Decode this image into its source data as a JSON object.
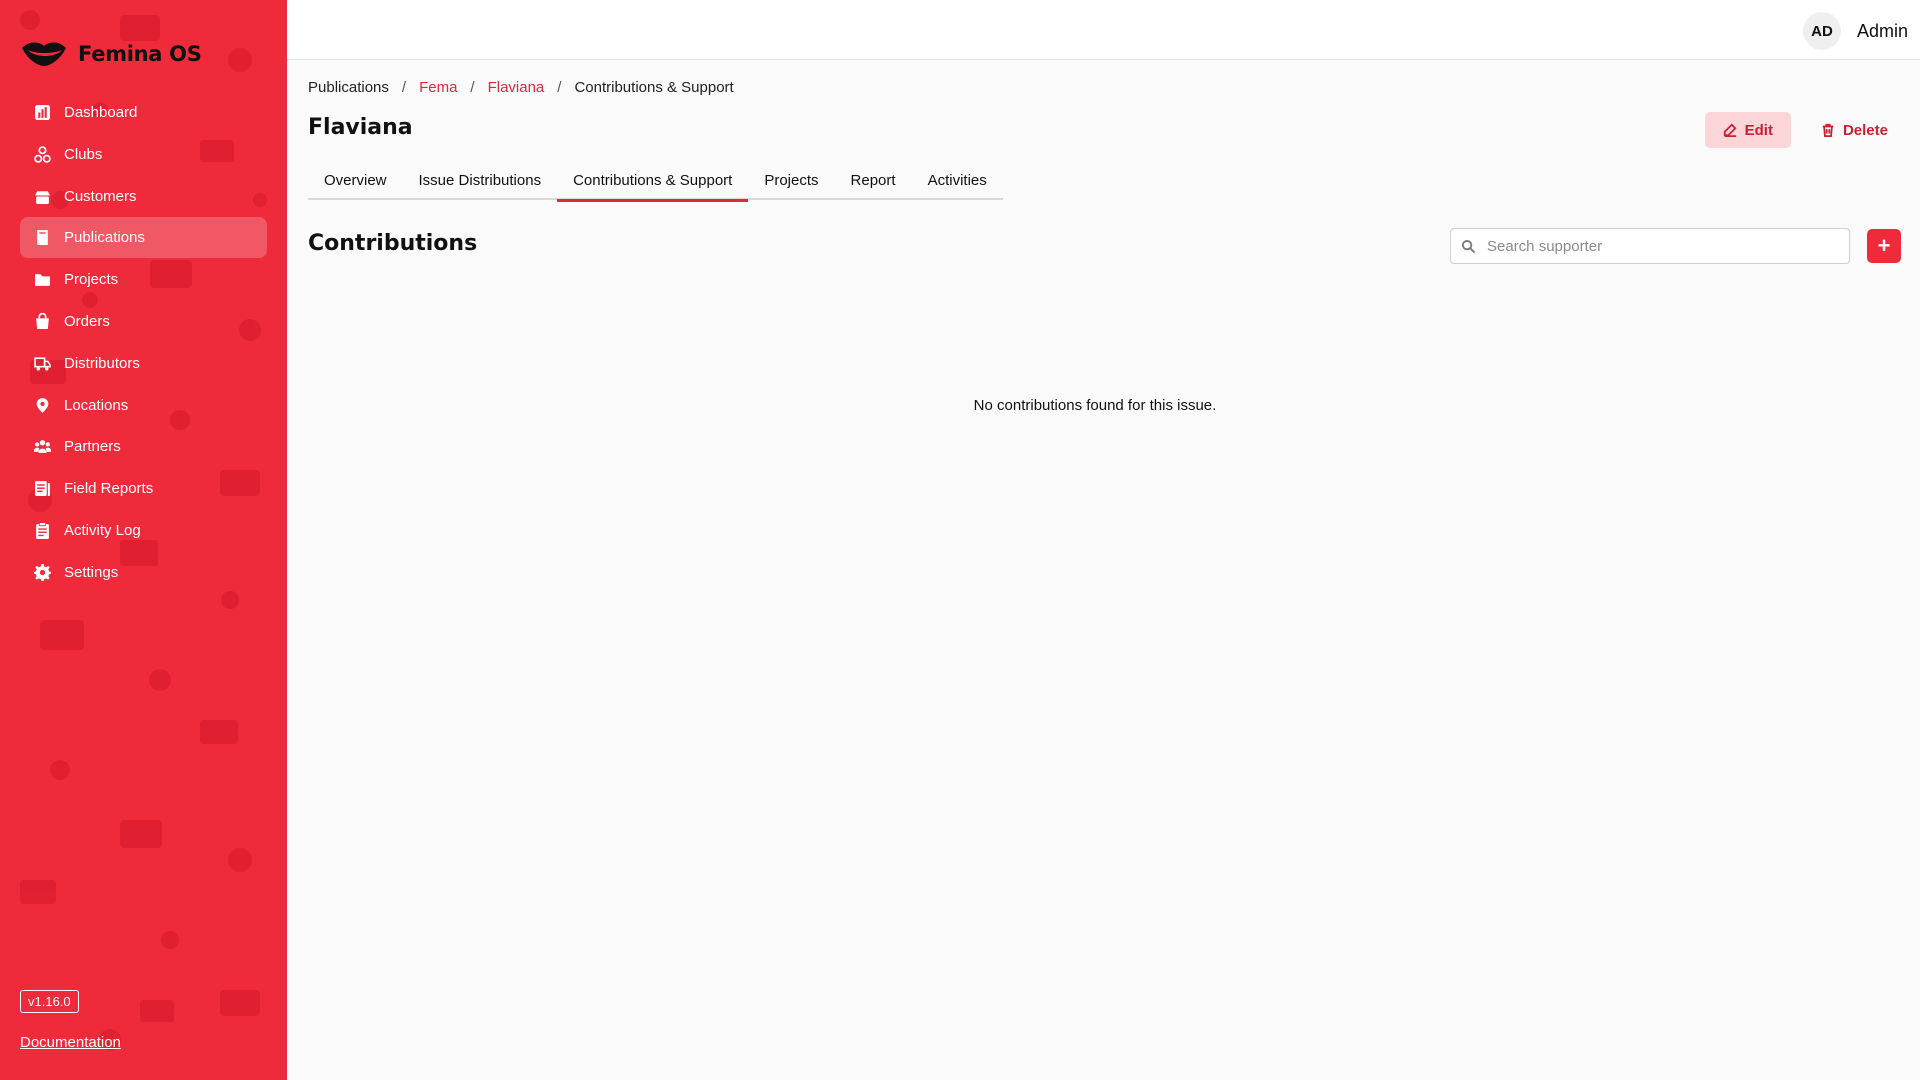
{
  "app": {
    "name": "Femina OS",
    "accent_color": "#ee2a3b",
    "version": "v1.16.0",
    "documentation_label": "Documentation"
  },
  "sidebar": {
    "items": [
      {
        "label": "Dashboard",
        "icon": "chart-icon"
      },
      {
        "label": "Clubs",
        "icon": "clubs-icon"
      },
      {
        "label": "Customers",
        "icon": "customers-icon"
      },
      {
        "label": "Publications",
        "icon": "book-icon",
        "active": true
      },
      {
        "label": "Projects",
        "icon": "folder-icon"
      },
      {
        "label": "Orders",
        "icon": "bag-icon"
      },
      {
        "label": "Distributors",
        "icon": "truck-icon"
      },
      {
        "label": "Locations",
        "icon": "pin-icon"
      },
      {
        "label": "Partners",
        "icon": "partners-icon"
      },
      {
        "label": "Field Reports",
        "icon": "report-icon"
      },
      {
        "label": "Activity Log",
        "icon": "clipboard-icon"
      },
      {
        "label": "Settings",
        "icon": "gear-icon"
      }
    ]
  },
  "header": {
    "user_initials": "AD",
    "user_name": "Admin"
  },
  "breadcrumb": [
    "Publications",
    "Fema",
    "Flaviana",
    "Contributions & Support"
  ],
  "page": {
    "title": "Flaviana",
    "edit_label": "Edit",
    "delete_label": "Delete"
  },
  "tabs": [
    {
      "label": "Overview"
    },
    {
      "label": "Issue Distributions"
    },
    {
      "label": "Contributions & Support",
      "active": true
    },
    {
      "label": "Projects"
    },
    {
      "label": "Report"
    },
    {
      "label": "Activities"
    }
  ],
  "contributions": {
    "title": "Contributions",
    "search_placeholder": "Search supporter",
    "search_value": "",
    "add_label": "+",
    "empty_message": "No contributions found for this issue."
  }
}
